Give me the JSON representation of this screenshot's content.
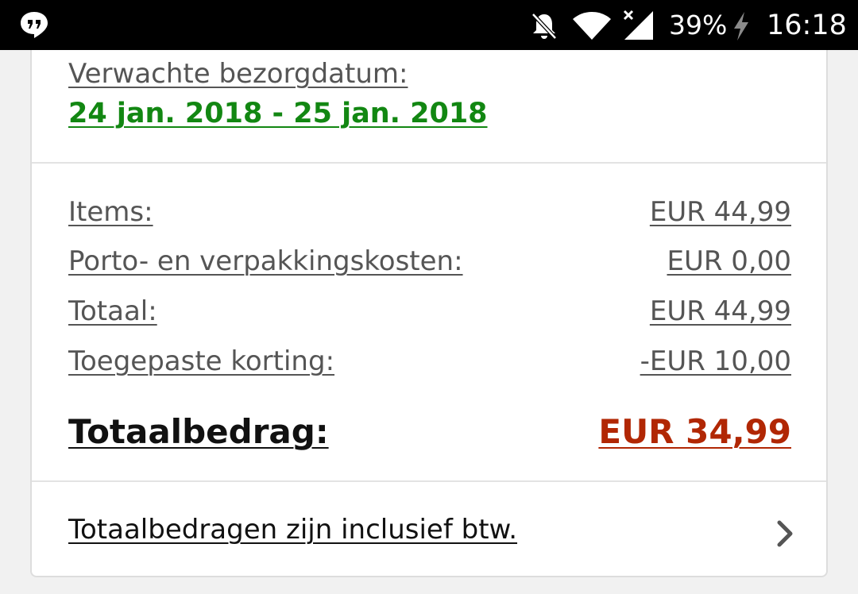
{
  "status_bar": {
    "battery": "39%",
    "time": "16:18",
    "icons": [
      "hangouts-icon",
      "bell-off-icon",
      "wifi-icon",
      "signal-icon",
      "charging-bolt-icon"
    ]
  },
  "delivery": {
    "label": "Verwachte bezorgdatum:",
    "date_range": "24 jan. 2018 - 25 jan. 2018"
  },
  "summary": {
    "rows": [
      {
        "label": "Items:",
        "value": "EUR 44,99"
      },
      {
        "label": "Porto- en verpakkingskosten:",
        "value": "EUR 0,00"
      },
      {
        "label": "Totaal:",
        "value": "EUR 44,99"
      },
      {
        "label": "Toegepaste korting:",
        "value": "-EUR 10,00"
      }
    ],
    "total_label": "Totaalbedrag:",
    "total_value": "EUR 34,99"
  },
  "footer": {
    "vat_link": "Totaalbedragen zijn inclusief btw.",
    "chevron_icon": "chevron-right-icon"
  },
  "colors": {
    "delivery_green": "#128712",
    "total_red": "#b12704",
    "status_bar": "#000000"
  }
}
